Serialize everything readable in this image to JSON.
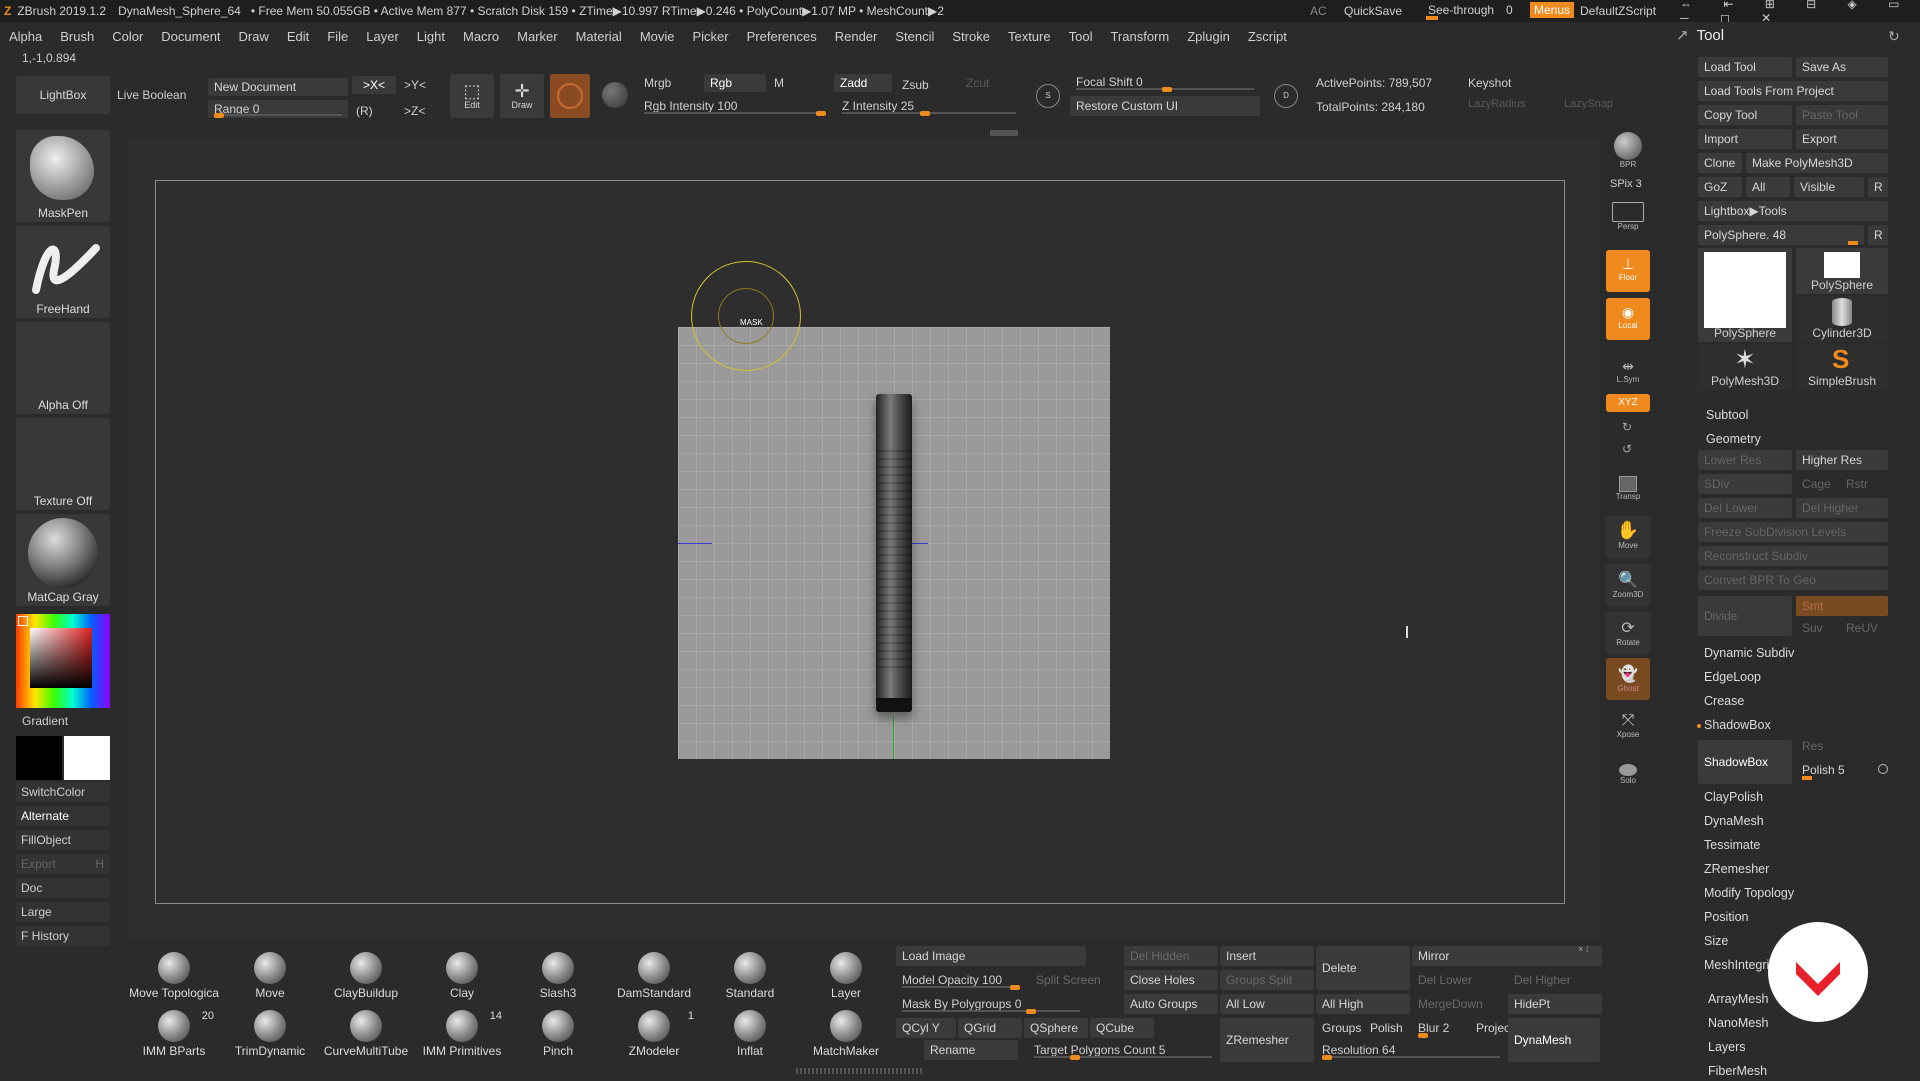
{
  "title_bar": {
    "app": "ZBrush 2019.1.2",
    "doc": "DynaMesh_Sphere_64",
    "stats": "• Free Mem 50.055GB • Active Mem 877 • Scratch Disk 159 • ZTime▶10.997 RTime▶0.246 • PolyCount▶1.07 MP • MeshCount▶2",
    "ac": "AC",
    "quicksave": "QuickSave",
    "see_through": "See-through",
    "see_through_value": "0",
    "menus": "Menus",
    "default_zscript": "DefaultZScript"
  },
  "menu_bar": [
    "Alpha",
    "Brush",
    "Color",
    "Document",
    "Draw",
    "Edit",
    "File",
    "Layer",
    "Light",
    "Macro",
    "Marker",
    "Material",
    "Movie",
    "Picker",
    "Preferences",
    "Render",
    "Stencil",
    "Stroke",
    "Texture",
    "Tool",
    "Transform",
    "Zplugin",
    "Zscript"
  ],
  "coords": "1,-1,0.894",
  "top_shelf": {
    "lightbox": "LightBox",
    "live_boolean": "Live Boolean",
    "new_document": "New Document",
    "range_label": "Range",
    "range_value": "0",
    "x_sym": ">X<",
    "y_sym": ">Y<",
    "z_sym": ">Z<",
    "r_label": "(R)",
    "edit": "Edit",
    "draw": "Draw",
    "mrgb": "Mrgb",
    "rgb": "Rgb",
    "m": "M",
    "rgb_intensity_label": "Rgb Intensity",
    "rgb_intensity_value": "100",
    "zadd": "Zadd",
    "zsub": "Zsub",
    "zcut": "Zcut",
    "z_intensity_label": "Z Intensity",
    "z_intensity_value": "25",
    "focal_shift_label": "Focal Shift",
    "focal_shift_value": "0",
    "restore_custom_ui": "Restore Custom UI",
    "active_points": "ActivePoints: 789,507",
    "total_points": "TotalPoints: 284,180",
    "keyshot": "Keyshot",
    "lazy_radius": "LazyRadius",
    "lazy_snap": "LazySnap"
  },
  "left_shelf": {
    "maskpen": "MaskPen",
    "freehand": "FreeHand",
    "alpha_off": "Alpha Off",
    "texture_off": "Texture Off",
    "matcap": "MatCap Gray",
    "gradient": "Gradient",
    "switch_color": "SwitchColor",
    "alternate": "Alternate",
    "fill_object": "FillObject",
    "export": "Export",
    "export_key": "H",
    "doc": "Doc",
    "large": "Large",
    "f_history": "F History"
  },
  "canvas": {
    "brush_cursor_label": "MASK"
  },
  "right_shelf": {
    "bpr": "BPR",
    "spix": "SPix 3",
    "persp": "Persp",
    "floor": "Floor",
    "local": "Local",
    "lsym": "L.Sym",
    "xyz": "XYZ",
    "transp": "Transp",
    "move": "Move",
    "zoom3d": "Zoom3D",
    "rotate": "Rotate",
    "ghost": "Ghost",
    "xpose": "Xpose",
    "solo": "Solo"
  },
  "tool_panel": {
    "title": "Tool",
    "load_tool": "Load Tool",
    "save_as": "Save As",
    "load_tools_from_project": "Load Tools From Project",
    "copy_tool": "Copy Tool",
    "paste_tool": "Paste Tool",
    "import": "Import",
    "export": "Export",
    "clone": "Clone",
    "make_polymesh": "Make PolyMesh3D",
    "goz": "GoZ",
    "all": "All",
    "visible": "Visible",
    "r": "R",
    "lightbox_tools": "Lightbox▶Tools",
    "current_tool": "PolySphere. 48",
    "tools": [
      "PolySphere",
      "PolySphere",
      "Cylinder3D",
      "PolyMesh3D",
      "SimpleBrush"
    ],
    "subtool": "Subtool",
    "geometry": "Geometry",
    "lower_res": "Lower Res",
    "higher_res": "Higher Res",
    "sdiv": "SDiv",
    "cage": "Cage",
    "rstr": "Rstr",
    "del_lower": "Del Lower",
    "del_higher": "Del Higher",
    "freeze_subdiv": "Freeze SubDivision Levels",
    "reconstruct_subdiv": "Reconstruct Subdiv",
    "convert_bpr": "Convert BPR To Geo",
    "divide": "Divide",
    "smt": "Smt",
    "suv": "Suv",
    "reuv": "ReUV",
    "dynamic_subdiv": "Dynamic Subdiv",
    "edgeloop": "EdgeLoop",
    "crease": "Crease",
    "shadowbox": "ShadowBox",
    "shadowbox_btn": "ShadowBox",
    "res": "Res",
    "polish": "Polish 5",
    "claypolish": "ClayPolish",
    "dynamesh": "DynaMesh",
    "tessimate": "Tessimate",
    "zremesher": "ZRemesher",
    "modify_topology": "Modify Topology",
    "position": "Position",
    "size": "Size",
    "meshintegrity": "MeshIntegrity",
    "arraymesh": "ArrayMesh",
    "nanomesh": "NanoMesh",
    "layers": "Layers",
    "fibermesh": "FiberMesh"
  },
  "bottom_brushes": [
    {
      "label": "Move Topologica"
    },
    {
      "label": "Move"
    },
    {
      "label": "ClayBuildup"
    },
    {
      "label": "Clay"
    },
    {
      "label": "Slash3"
    },
    {
      "label": "DamStandard"
    },
    {
      "label": "Standard"
    },
    {
      "label": "Layer"
    },
    {
      "label": "IMM BParts",
      "count": "20"
    },
    {
      "label": "TrimDynamic"
    },
    {
      "label": "CurveMultiTube"
    },
    {
      "label": "IMM Primitives",
      "count": "14"
    },
    {
      "label": "Pinch"
    },
    {
      "label": "ZModeler",
      "count": "1"
    },
    {
      "label": "Inflat"
    },
    {
      "label": "MatchMaker"
    }
  ],
  "bottom_controls": {
    "load_image": "Load Image",
    "model_opacity": "Model Opacity 100",
    "split_screen": "Split Screen",
    "mask_by_polygroups": "Mask By Polygroups 0",
    "qcyl_y": "QCyl Y",
    "qgrid": "QGrid",
    "qsphere": "QSphere",
    "qcube": "QCube",
    "rename": "Rename",
    "target_polygons": "Target Polygons Count 5",
    "del_hidden": "Del Hidden",
    "close_holes": "Close Holes",
    "groups_split": "Groups Split",
    "auto_groups": "Auto Groups",
    "insert": "Insert",
    "delete": "Delete",
    "all_low": "All Low",
    "all_high": "All High",
    "zremesher": "ZRemesher",
    "mirror": "Mirror",
    "del_lower": "Del Lower",
    "del_higher": "Del Higher",
    "merge_down": "MergeDown",
    "hidept": "HidePt",
    "groups": "Groups",
    "polish": "Polish",
    "blur": "Blur 2",
    "project": "Project",
    "resolution": "Resolution 64",
    "dynamesh": "DynaMesh"
  },
  "colors": {
    "accent": "#f08a1c",
    "background": "#2b2b2b",
    "canvas_bg": "#2f2f2f",
    "plane": "#9a9a9a"
  }
}
